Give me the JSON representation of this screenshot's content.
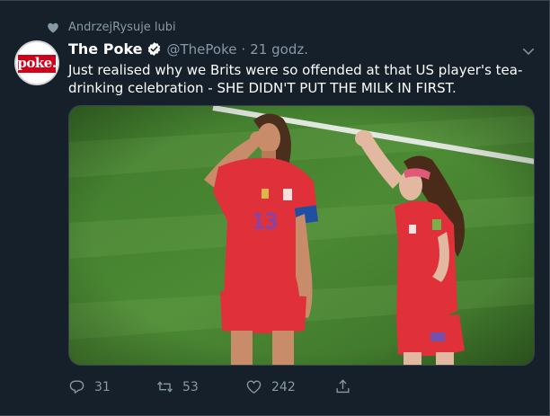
{
  "social_context": {
    "icon": "heart-icon",
    "text": "AndrzejRysuje lubi"
  },
  "author": {
    "avatar_logo_small": "the",
    "avatar_logo": "poke.",
    "name": "The Poke",
    "verified": true,
    "handle": "@ThePoke",
    "separator": "·",
    "time": "21 godz."
  },
  "tweet": {
    "text": "Just realised why we Brits were so offended at that US player's tea-drinking celebration - SHE DIDN'T PUT THE MILK IN FIRST."
  },
  "media": {
    "alt": "photo",
    "jersey_number": "13"
  },
  "actions": {
    "reply_count": "31",
    "retweet_count": "53",
    "like_count": "242"
  },
  "colors": {
    "background": "#15202b",
    "muted": "#8899a6",
    "border": "#38444d",
    "jersey_red": "#e0303a"
  }
}
